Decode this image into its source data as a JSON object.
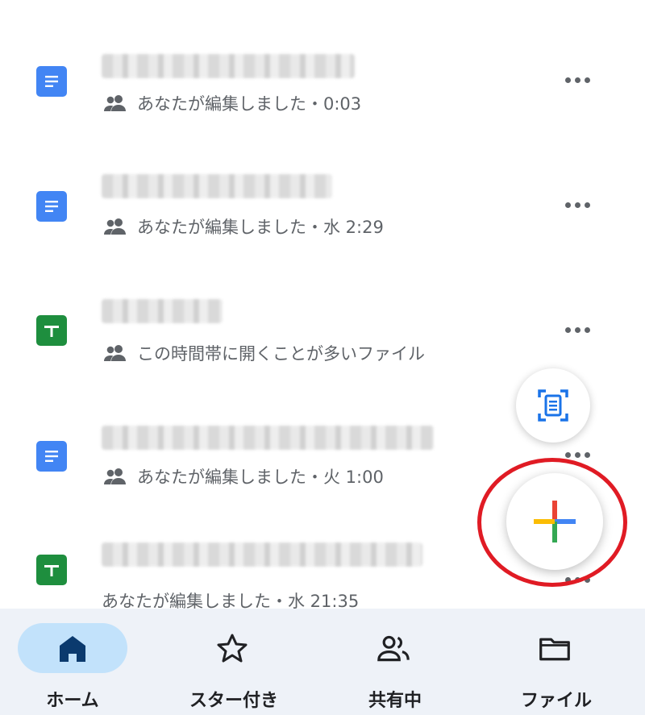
{
  "files": [
    {
      "type": "doc",
      "meta_text": "あなたが編集しました・0:03",
      "shared": true
    },
    {
      "type": "doc",
      "meta_text": "あなたが編集しました・水 2:29",
      "shared": true
    },
    {
      "type": "sheet",
      "meta_text": "この時間帯に開くことが多いファイル",
      "shared": true
    },
    {
      "type": "doc",
      "meta_text": "あなたが編集しました・火 1:00",
      "shared": true
    },
    {
      "type": "sheet",
      "meta_text": "あなたが編集しました・水 21:35",
      "shared": false
    }
  ],
  "fab": {
    "scan_icon": "document-scan-icon",
    "new_icon": "google-plus-icon"
  },
  "nav": {
    "home_label": "ホーム",
    "starred_label": "スター付き",
    "shared_label": "共有中",
    "files_label": "ファイル"
  },
  "colors": {
    "doc_blue": "#4285f4",
    "sheet_green": "#1e8e3e",
    "nav_background": "#eef2f8",
    "nav_active_pill": "#c2e2fb",
    "highlight_red": "#e01b24"
  }
}
